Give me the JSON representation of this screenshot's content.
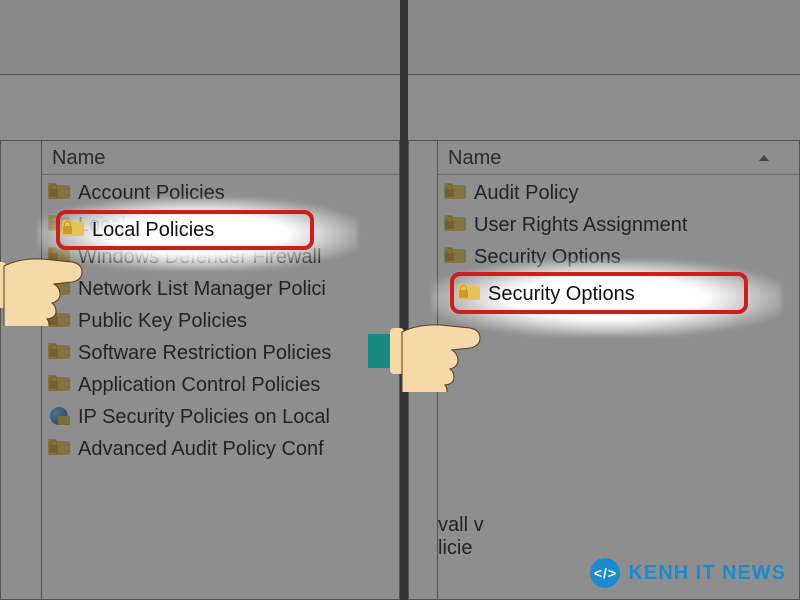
{
  "left": {
    "header": "Name",
    "items": [
      {
        "label": "Account Policies",
        "icon": "folder"
      },
      {
        "label": "Local Policies",
        "icon": "folder",
        "highlight": true
      },
      {
        "label": "Windows Defender Firewall",
        "icon": "folder"
      },
      {
        "label": "Network List Manager Polici",
        "icon": "folder"
      },
      {
        "label": "Public Key Policies",
        "icon": "folder"
      },
      {
        "label": "Software Restriction Policies",
        "icon": "folder"
      },
      {
        "label": "Application Control Policies",
        "icon": "folder"
      },
      {
        "label": "IP Security Policies on Local",
        "icon": "globe"
      },
      {
        "label": "Advanced Audit Policy Conf",
        "icon": "folder"
      }
    ]
  },
  "right": {
    "header": "Name",
    "items": [
      {
        "label": "Audit Policy",
        "icon": "folder"
      },
      {
        "label": "User Rights Assignment",
        "icon": "folder"
      },
      {
        "label": "Security Options",
        "icon": "folder",
        "highlight": true
      }
    ],
    "peek_lines": [
      "vall v",
      "licie"
    ]
  },
  "watermark": {
    "logo_glyph": "</>",
    "text": "KENH IT NEWS"
  },
  "colors": {
    "accent_red": "#d11c1c",
    "brand_blue": "#1b8bd1"
  }
}
